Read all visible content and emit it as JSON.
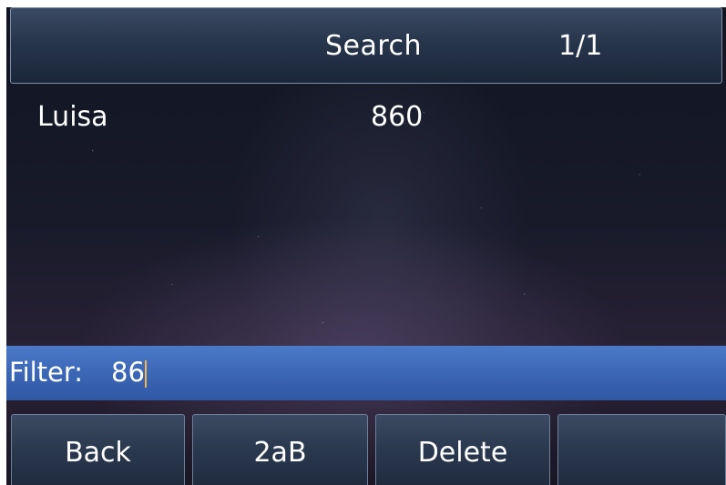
{
  "header": {
    "title": "Search",
    "page_indicator": "1/1"
  },
  "results": [
    {
      "name": "Luisa",
      "number": "860"
    }
  ],
  "filter": {
    "label": "Filter:",
    "value": "86"
  },
  "softkeys": [
    {
      "label": "Back"
    },
    {
      "label": "2aB"
    },
    {
      "label": "Delete"
    },
    {
      "label": ""
    }
  ],
  "colors": {
    "filter_bar": "#3c67b6",
    "caret": "#f2b64a",
    "header": "#26344a"
  }
}
